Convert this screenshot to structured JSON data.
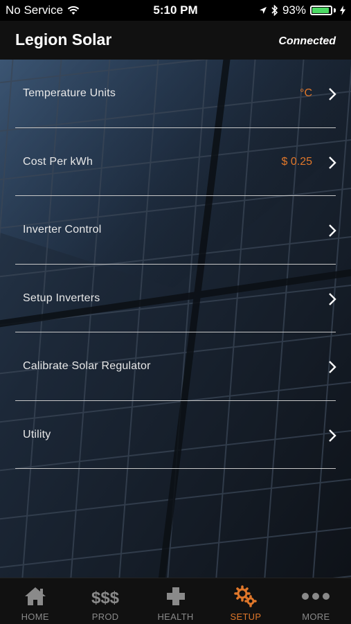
{
  "status_bar": {
    "carrier": "No Service",
    "time": "5:10 PM",
    "battery_percent": "93%",
    "battery_level": 0.93,
    "battery_color": "#4cd964"
  },
  "nav": {
    "title": "Legion Solar",
    "connection_status": "Connected"
  },
  "menu": {
    "items": [
      {
        "label": "Temperature Units",
        "value": "°C"
      },
      {
        "label": "Cost Per kWh",
        "value": "$ 0.25"
      },
      {
        "label": "Inverter Control",
        "value": ""
      },
      {
        "label": "Setup Inverters",
        "value": ""
      },
      {
        "label": "Calibrate Solar Regulator",
        "value": ""
      },
      {
        "label": "Utility",
        "value": ""
      }
    ]
  },
  "tabs": {
    "items": [
      {
        "label": "HOME",
        "icon": "home-icon"
      },
      {
        "label": "PROD",
        "icon": "dollar-signs-icon"
      },
      {
        "label": "HEALTH",
        "icon": "plus-cross-icon"
      },
      {
        "label": "SETUP",
        "icon": "gears-icon"
      },
      {
        "label": "MORE",
        "icon": "ellipsis-icon"
      }
    ],
    "active": "SETUP"
  },
  "colors": {
    "accent": "#e0772a",
    "inactive": "#8a8a8a"
  }
}
